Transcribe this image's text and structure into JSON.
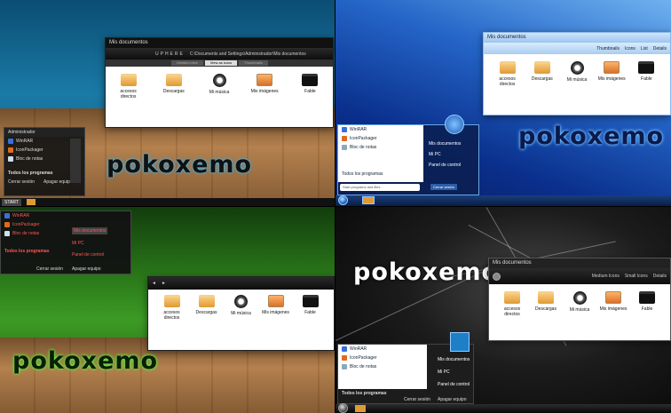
{
  "brand_text": "pokoxemo",
  "q1": {
    "window": {
      "title": "Mis documentos",
      "toolbar_label": "UPHERE",
      "address": "C:\\Documents and Settings\\Administrador\\Mis documentos",
      "tabs": [
        "Detailed view",
        "View as icons",
        "Thumbnails"
      ]
    },
    "files": [
      "accesos directos",
      "Descargas",
      "Mi música",
      "Mis imágenes",
      "Fable"
    ],
    "start": {
      "header": "Administrador",
      "items": [
        "WinRAR",
        "IconPackager",
        "Bloc de notas"
      ],
      "all_programs": "Todos los programas",
      "logoff": "Cerrar sesión",
      "shutdown": "Apagar equipo"
    },
    "taskbar_start": "START"
  },
  "q2": {
    "window": {
      "title": "Mis documentos",
      "view_buttons": [
        "Thumbnails",
        "Icons",
        "List",
        "Details"
      ]
    },
    "files": [
      "accesos directos",
      "Descargas",
      "Mi música",
      "Mis imágenes",
      "Fable"
    ],
    "start": {
      "items": [
        "WinRAR",
        "IconPackager",
        "Bloc de notas"
      ],
      "right_items": [
        "Mis documentos",
        "Mi PC",
        "Panel de control"
      ],
      "all_programs": "Todos los programas",
      "search": "Start programs and files",
      "shutdown": "Cerrar sesión"
    }
  },
  "q3": {
    "files": [
      "accesos directos",
      "Descargas",
      "Mi música",
      "Mis imágenes",
      "Fable"
    ],
    "start": {
      "items": [
        "WinRAR",
        "IconPackager",
        "Bloc de notas"
      ],
      "right_items": [
        "Mis documentos",
        "Mi PC",
        "Panel de control"
      ],
      "all_programs": "Todos los programas",
      "logoff": "Cerrar sesión",
      "shutdown": "Apagar equipo"
    }
  },
  "q4": {
    "window": {
      "title": "Mis documentos",
      "view_buttons": [
        "Medium Icons",
        "Small Icons",
        "Details"
      ]
    },
    "files": [
      "accesos directos",
      "Descargas",
      "Mi música",
      "Mis imágenes",
      "Fable"
    ],
    "start": {
      "items": [
        "WinRAR",
        "IconPackager",
        "Bloc de notas"
      ],
      "right_items": [
        "Mis documentos",
        "Mi PC",
        "Panel de control"
      ],
      "all_programs": "Todos los programas",
      "logoff": "Cerrar sesión",
      "shutdown": "Apagar equipo"
    }
  }
}
